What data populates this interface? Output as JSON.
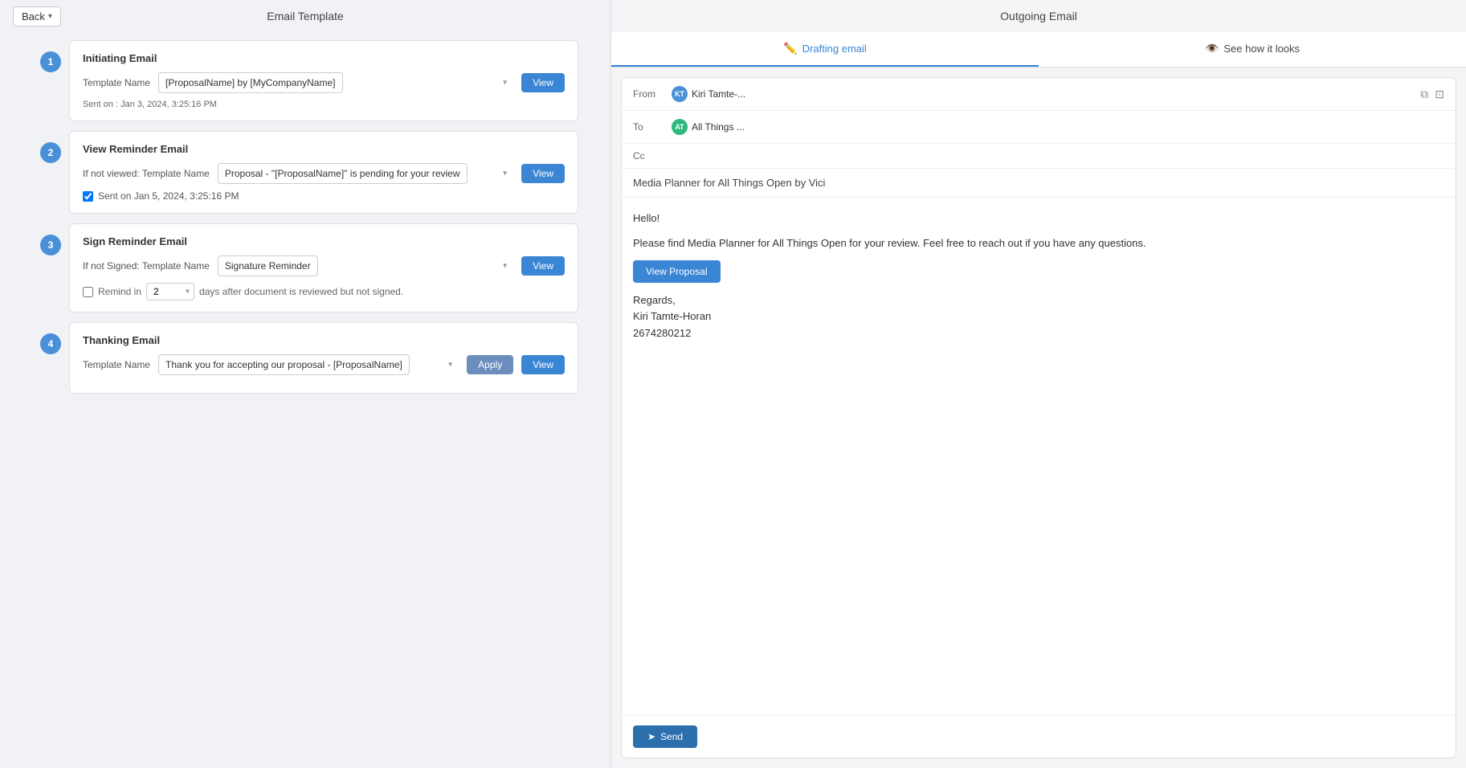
{
  "header": {
    "back_label": "Back",
    "page_title": "Email Template",
    "right_title": "Outgoing Email"
  },
  "steps": [
    {
      "number": "1",
      "section_title": "Initiating Email",
      "field_label": "Template Name",
      "template_value": "[ProposalName] by [MyCompanyName]",
      "sent_info": "Sent on : Jan 3, 2024, 3:25:16 PM",
      "view_label": "View",
      "has_checkbox": false,
      "checkbox_checked": false,
      "checkbox_label": "",
      "has_remind": false
    },
    {
      "number": "2",
      "section_title": "View Reminder Email",
      "field_label": "If not viewed: Template Name",
      "template_value": "Proposal - \"[ProposalName]\" is pending for your review",
      "sent_info": "",
      "view_label": "View",
      "has_checkbox": true,
      "checkbox_checked": true,
      "checkbox_label": "Sent on Jan 5, 2024, 3:25:16 PM",
      "has_remind": false
    },
    {
      "number": "3",
      "section_title": "Sign Reminder Email",
      "field_label": "If not Signed: Template Name",
      "template_value": "Signature Reminder",
      "sent_info": "",
      "view_label": "View",
      "has_checkbox": false,
      "checkbox_checked": false,
      "checkbox_label": "",
      "has_remind": true,
      "remind_label": "Remind in",
      "remind_value": "2",
      "remind_suffix": "days after document is reviewed but not signed."
    },
    {
      "number": "4",
      "section_title": "Thanking Email",
      "field_label": "Template Name",
      "template_value": "Thank you for accepting our proposal - [ProposalName]",
      "sent_info": "",
      "view_label": "View",
      "apply_label": "Apply",
      "has_checkbox": false,
      "has_remind": false
    }
  ],
  "tabs": [
    {
      "label": "Drafting email",
      "icon": "✏️",
      "active": true
    },
    {
      "label": "See how it looks",
      "icon": "👁️",
      "active": false
    }
  ],
  "email": {
    "from_label": "From",
    "from_avatar_initials": "KT",
    "from_name": "Kiri Tamte-...",
    "to_label": "To",
    "to_avatar_initials": "AT",
    "to_name": "All Things ...",
    "cc_label": "Cc",
    "subject": "Media Planner for All Things Open by Vici",
    "body_greeting": "Hello!",
    "body_paragraph": "Please find Media Planner for All Things Open for your review. Feel free to reach out if you have any questions.",
    "view_proposal_label": "View Proposal",
    "regards_label": "Regards,",
    "sender_name": "Kiri Tamte-Horan",
    "sender_phone": "2674280212",
    "send_label": "Send"
  }
}
